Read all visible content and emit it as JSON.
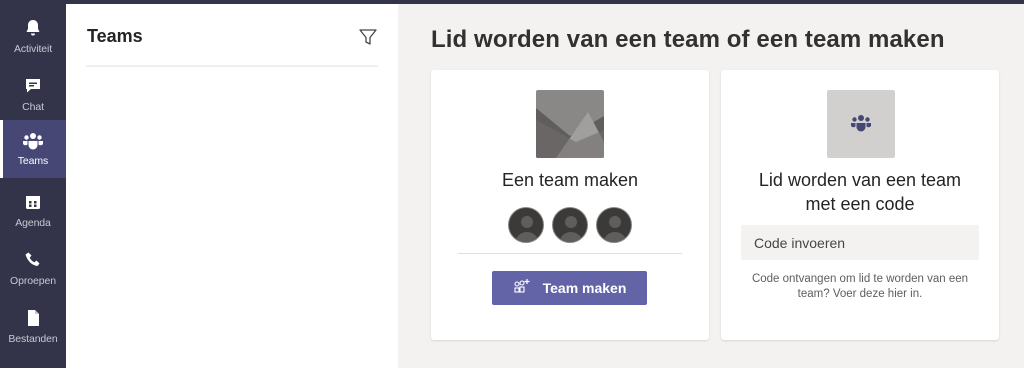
{
  "rail": {
    "items": [
      {
        "label": "Activiteit",
        "icon": "bell-icon",
        "active": false
      },
      {
        "label": "Chat",
        "icon": "chat-icon",
        "active": false
      },
      {
        "label": "Teams",
        "icon": "teams-icon",
        "active": true
      },
      {
        "label": "Agenda",
        "icon": "calendar-icon",
        "active": false
      },
      {
        "label": "Oproepen",
        "icon": "phone-icon",
        "active": false
      },
      {
        "label": "Bestanden",
        "icon": "file-icon",
        "active": false
      }
    ]
  },
  "list_panel": {
    "title": "Teams",
    "filter_icon": "filter-icon"
  },
  "main": {
    "title": "Lid worden van een team of een team maken",
    "create_card": {
      "heading": "Een team maken",
      "button_label": "Team maken",
      "button_icon": "add-team-icon"
    },
    "join_card": {
      "heading": "Lid worden van een team met een code",
      "input_placeholder": "Code invoeren",
      "help_text": "Code ontvangen om lid te worden van een team? Voer deze hier in."
    }
  },
  "colors": {
    "rail_bg": "#33344a",
    "rail_active": "#464775",
    "brand": "#6264a7",
    "page_bg": "#f3f2f1"
  }
}
